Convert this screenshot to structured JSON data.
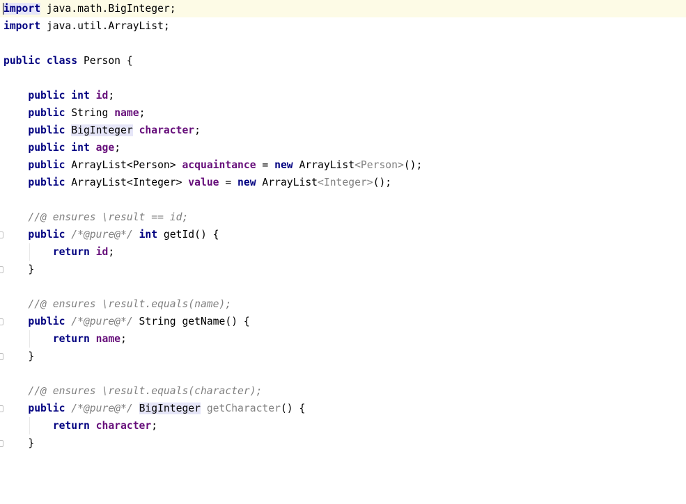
{
  "kw": {
    "import": "import",
    "public": "public",
    "class": "class",
    "int": "int",
    "new": "new",
    "return": "return"
  },
  "lines": {
    "import_math_rest": " java.math.BigInteger;",
    "import_util_rest": " java.util.ArrayList;",
    "class_name": " Person {",
    "id_field": "id",
    "string_type": " String ",
    "name_field": "name",
    "biginteger_type": "BigInteger",
    "character_field": "character",
    "age_field": "age",
    "list_person_type": " ArrayList<Person> ",
    "acquaintance_field": "acquaintance",
    "list_person_new": " ArrayList",
    "person_generic": "<Person>",
    "new_tail": "();",
    "list_integer_type": " ArrayList<Integer> ",
    "value_field": "value",
    "list_integer_new": " ArrayList",
    "integer_generic": "<Integer>",
    "comment_getid": "//@ ensures \\result == id;",
    "pure_annotation": "/*@pure@*/",
    "getid_sig": " getId() {",
    "closing_brace": "}",
    "comment_getname": "//@ ensures \\result.equals(name);",
    "getname_sig": " String getName() {",
    "comment_getcharacter": "//@ ensures \\result.equals(character);",
    "getcharacter_name": "getCharacter",
    "getcharacter_tail": "() {"
  }
}
